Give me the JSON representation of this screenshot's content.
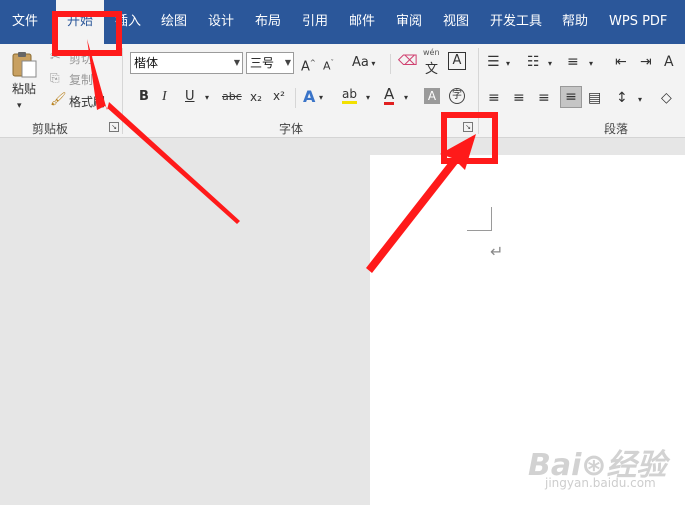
{
  "tabs": [
    "文件",
    "开始",
    "插入",
    "绘图",
    "设计",
    "布局",
    "引用",
    "邮件",
    "审阅",
    "视图",
    "开发工具",
    "帮助",
    "WPS PDF"
  ],
  "active_tab": "开始",
  "clipboard": {
    "paste": "粘贴",
    "cut": "剪切",
    "copy": "复制",
    "format_painter": "格式刷",
    "group": "剪贴板"
  },
  "font": {
    "name": "楷体",
    "size": "三号",
    "case": "Aa",
    "phonetic_top": "wén",
    "phonetic_char": "文",
    "border_char": "A",
    "bold": "B",
    "italic": "I",
    "underline": "U",
    "strike": "abc",
    "subscript": "x₂",
    "superscript": "x²",
    "effect": "A",
    "highlight": "ab",
    "color_a": "A",
    "shade_a": "A",
    "group": "字体"
  },
  "paragraph": {
    "group": "段落"
  },
  "watermark": {
    "logo": "Bai⊛经验",
    "url": "jingyan.baidu.com"
  },
  "colors": {
    "ribbon_blue": "#2b579a",
    "highlight_red": "#ff1a1a"
  }
}
